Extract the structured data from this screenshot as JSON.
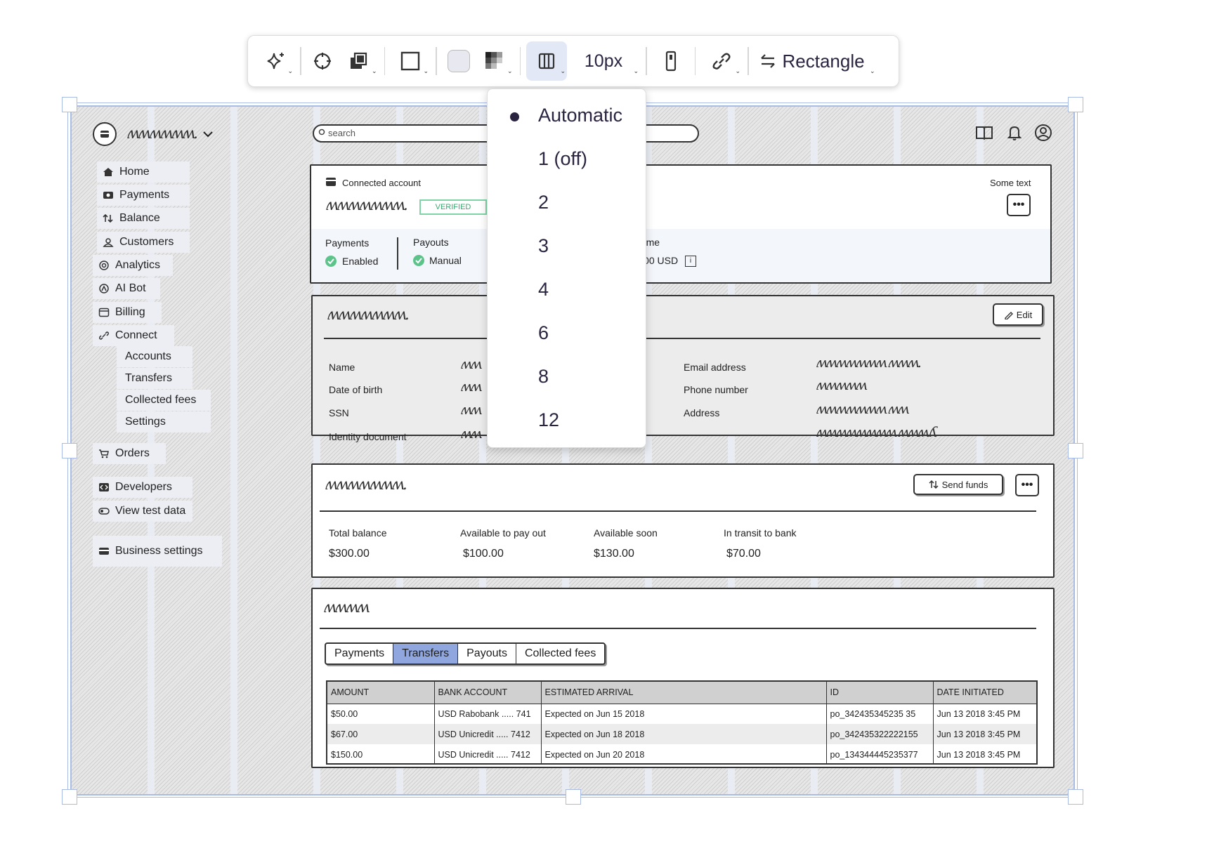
{
  "toolbar": {
    "padding_label": "10px",
    "shape_label": "Rectangle",
    "fill_color": "#e8e9f0",
    "active_color": "#e3e8f7"
  },
  "columns_menu": {
    "options": [
      "Automatic",
      "1 (off)",
      "2",
      "3",
      "4",
      "6",
      "8",
      "12"
    ],
    "selected": "Automatic"
  },
  "app": {
    "search_placeholder": "search"
  },
  "sidebar": {
    "items": [
      {
        "label": "Home",
        "icon": "home-icon"
      },
      {
        "label": "Payments",
        "icon": "payments-icon"
      },
      {
        "label": "Balance",
        "icon": "balance-icon"
      },
      {
        "label": "Customers",
        "icon": "customers-icon"
      },
      {
        "label": "Analytics",
        "icon": "analytics-icon"
      },
      {
        "label": "AI Bot",
        "icon": "ai-bot-icon"
      },
      {
        "label": "Billing",
        "icon": "billing-icon"
      },
      {
        "label": "Connect",
        "icon": "connect-icon"
      },
      {
        "label": "Orders",
        "icon": "orders-icon"
      },
      {
        "label": "Developers",
        "icon": "developers-icon"
      },
      {
        "label": "View test data",
        "icon": "toggle-icon"
      },
      {
        "label": "Business settings",
        "icon": "store-icon"
      }
    ],
    "connect_subitems": [
      "Accounts",
      "Transfers",
      "Collected fees",
      "Settings"
    ]
  },
  "account_card": {
    "title": "Connected account",
    "badge": "VERIFIED",
    "right_text": "Some text",
    "payments_label": "Payments",
    "payments_status": "Enabled",
    "payouts_label": "Payouts",
    "payouts_status": "Manual",
    "lifetime_label": "Lifetime volume",
    "lifetime_value": "5550.00 USD",
    "info_glyph": "i"
  },
  "details_card": {
    "edit_label": "Edit",
    "left_labels": [
      "Name",
      "Date of birth",
      "SSN",
      "Identity document"
    ],
    "right_labels": [
      "Email address",
      "Phone number",
      "Address"
    ]
  },
  "balance_card": {
    "send_label": "Send funds",
    "metrics": [
      {
        "label": "Total balance",
        "value": "$300.00"
      },
      {
        "label": "Available to pay out",
        "value": "$100.00"
      },
      {
        "label": "Available soon",
        "value": "$130.00"
      },
      {
        "label": "In transit to bank",
        "value": "$70.00"
      }
    ]
  },
  "transfers_card": {
    "tabs": [
      "Payments",
      "Transfers",
      "Payouts",
      "Collected fees"
    ],
    "active_tab": "Transfers",
    "columns": [
      "AMOUNT",
      "BANK ACCOUNT",
      "ESTIMATED ARRIVAL",
      "ID",
      "DATE INITIATED"
    ],
    "rows": [
      [
        "$50.00",
        "USD Rabobank ..... 741",
        "Expected on Jun 15 2018",
        "po_342435345235 35",
        "Jun 13 2018 3:45 PM"
      ],
      [
        "$67.00",
        "USD Unicredit ..... 7412",
        "Expected on Jun 18 2018",
        "po_342435322222155",
        "Jun 13 2018 3:45 PM"
      ],
      [
        "$150.00",
        "USD Unicredit ..... 7412",
        "Expected on Jun 20 2018",
        "po_134344445235377",
        "Jun 13 2018 3:45 PM"
      ]
    ]
  }
}
